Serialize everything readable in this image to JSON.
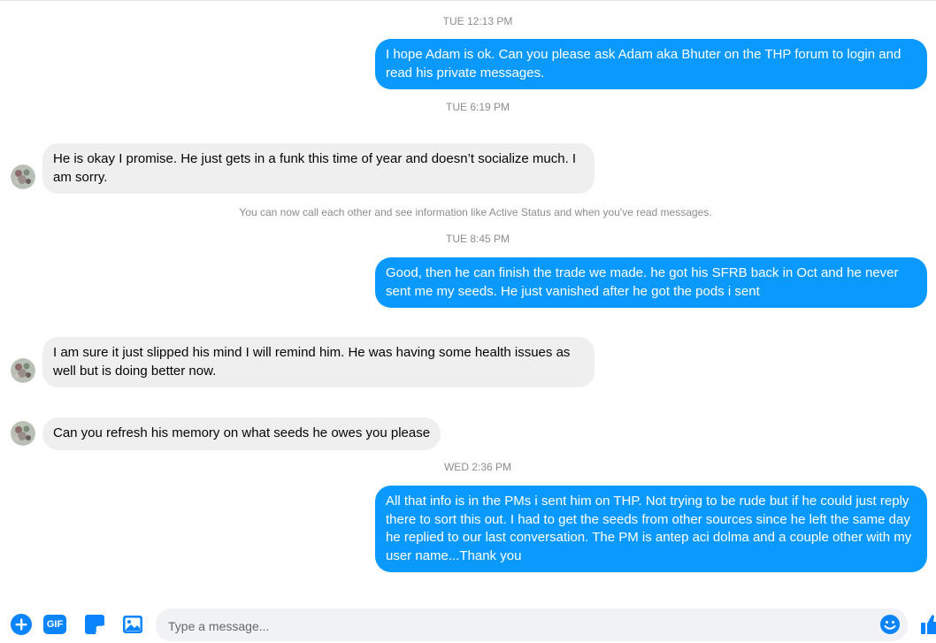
{
  "conversation": {
    "timestamps": [
      "TUE 12:13 PM",
      "TUE 6:19 PM",
      "TUE 8:45 PM",
      "WED 2:36 PM"
    ],
    "notice": "You can now call each other and see information like Active Status and when you've read messages.",
    "messages": [
      {
        "direction": "outgoing",
        "text": "I hope Adam is ok. Can you please ask Adam aka Bhuter on the THP forum to login and read his private messages."
      },
      {
        "direction": "incoming",
        "text": "He is okay I promise. He just gets in a funk this time of year and doesn’t socialize much. I am sorry."
      },
      {
        "direction": "outgoing",
        "text": "Good, then he can finish the trade we made. he got his SFRB back in Oct and he never sent me my seeds. He just vanished after he got the pods i sent"
      },
      {
        "direction": "incoming",
        "text": "I am sure it just slipped his mind I will remind him. He was having some health issues as well but is doing better now."
      },
      {
        "direction": "incoming",
        "text": "Can you refresh his memory on what seeds he owes you please"
      },
      {
        "direction": "outgoing",
        "text": "All that info is in the PMs i sent him on THP. Not trying to be rude but if he could just reply there to sort this out. I had to get the seeds from other sources since he left the same day he replied to our last conversation. The PM is antep aci dolma and a couple other with my user name...Thank you"
      }
    ]
  },
  "composer": {
    "placeholder": "Type a message...",
    "value": "",
    "tools": [
      "add-icon",
      "gif-icon",
      "sticker-icon",
      "photo-icon"
    ],
    "gif_label": "GIF",
    "emoji_icon": "smiley-icon",
    "send_icon": "thumbs-up-icon"
  },
  "colors": {
    "accent": "#0a99ff",
    "outgoing_bubble": "#0a99ff",
    "incoming_bubble": "#efeff0",
    "meta_text": "#8a8d91"
  }
}
